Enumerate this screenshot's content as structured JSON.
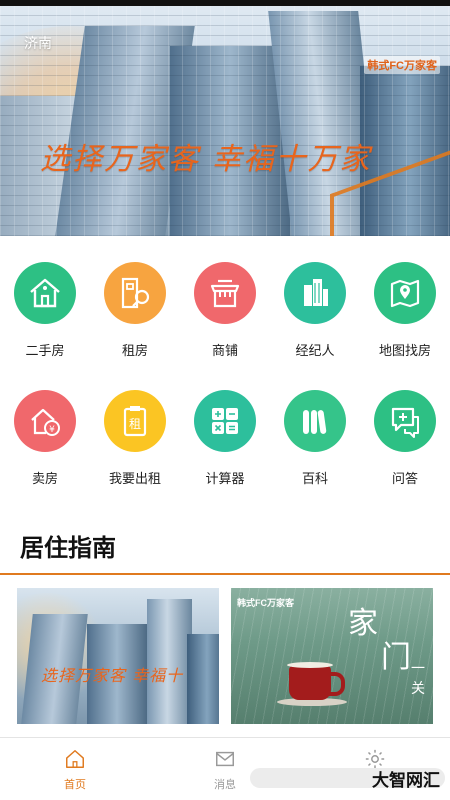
{
  "header": {
    "city": "济南",
    "brand_logo": "韩式FC万家客",
    "banner_slogan": "选择万家客 幸福十万家"
  },
  "menu": {
    "row1": [
      {
        "label": "二手房",
        "color": "#2dc084",
        "icon": "house-icon"
      },
      {
        "label": "租房",
        "color": "#f7a440",
        "icon": "rent-key-icon"
      },
      {
        "label": "商铺",
        "color": "#f0686c",
        "icon": "shop-icon"
      },
      {
        "label": "经纪人",
        "color": "#2dbf9c",
        "icon": "building-agent-icon"
      },
      {
        "label": "地图找房",
        "color": "#2dc084",
        "icon": "map-pin-icon"
      }
    ],
    "row2": [
      {
        "label": "卖房",
        "color": "#f0686c",
        "icon": "sell-house-icon"
      },
      {
        "label": "我要出租",
        "color": "#fbc523",
        "icon": "rent-clipboard-icon"
      },
      {
        "label": "计算器",
        "color": "#2dbf9c",
        "icon": "calculator-icon"
      },
      {
        "label": "百科",
        "color": "#35c48a",
        "icon": "books-icon"
      },
      {
        "label": "问答",
        "color": "#2dc084",
        "icon": "qa-chat-icon"
      }
    ],
    "rent_char": "租"
  },
  "section": {
    "title": "居住指南"
  },
  "cards": [
    {
      "slogan": "选择万家客 幸福十"
    },
    {
      "logo": "韩式FC万家客",
      "big_text_1": "家",
      "big_text_2": "门",
      "big_text_3": "一关"
    }
  ],
  "bottom_nav": [
    {
      "label": "首页",
      "active": true
    },
    {
      "label": "消息",
      "active": false
    },
    {
      "label": "",
      "active": false
    }
  ],
  "watermark": "大智网汇",
  "colors": {
    "accent": "#e07a1f",
    "nav_active": "#e07a1f",
    "nav_inactive": "#999999"
  }
}
